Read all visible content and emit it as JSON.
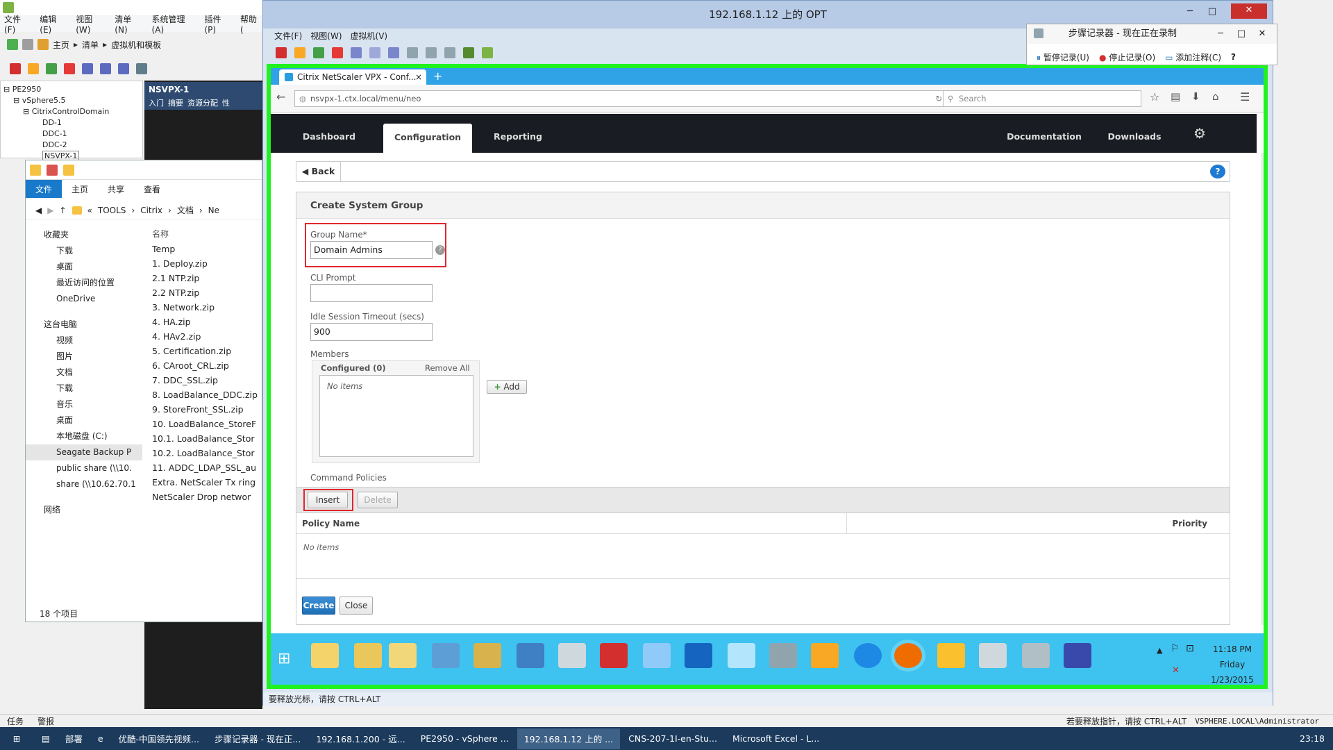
{
  "vsphere": {
    "menu": [
      "文件(F)",
      "编辑(E)",
      "视图(W)",
      "清单(N)",
      "系统管理(A)",
      "插件(P)",
      "帮助("
    ],
    "nav": {
      "home": "主页",
      "inventory": "清单",
      "vms": "虚拟机和模板"
    },
    "tree": [
      "PE2950",
      "vSphere5.5",
      "CitrixControlDomain",
      "DD-1",
      "DDC-1",
      "DDC-2",
      "NSVPX-1"
    ],
    "right_title": "NSVPX-1",
    "right_tabs": [
      "入门",
      "摘要",
      "资源分配",
      "性"
    ],
    "status_left": [
      "任务",
      "警报"
    ],
    "status_right": "若要释放指针，请按 CTRL+ALT",
    "status_user": "VSPHERE.LOCAL\\Administrator"
  },
  "explorer": {
    "ribbon": [
      "文件",
      "主页",
      "共享",
      "查看"
    ],
    "path": [
      "«",
      "TOOLS",
      "Citrix",
      "文档",
      "Ne"
    ],
    "nav": [
      {
        "label": "收藏夹",
        "group": true
      },
      {
        "label": "下载"
      },
      {
        "label": "桌面"
      },
      {
        "label": "最近访问的位置"
      },
      {
        "label": "OneDrive"
      },
      {
        "label": "这台电脑",
        "group": true
      },
      {
        "label": "视频"
      },
      {
        "label": "图片"
      },
      {
        "label": "文档"
      },
      {
        "label": "下载"
      },
      {
        "label": "音乐"
      },
      {
        "label": "桌面"
      },
      {
        "label": "本地磁盘 (C:)"
      },
      {
        "label": "Seagate Backup P"
      },
      {
        "label": "public share (\\\\10."
      },
      {
        "label": "share (\\\\10.62.70.1"
      },
      {
        "label": "网络",
        "group": true
      }
    ],
    "col_header": "名称",
    "files": [
      "Temp",
      "1. Deploy.zip",
      "2.1 NTP.zip",
      "2.2 NTP.zip",
      "3. Network.zip",
      "4. HA.zip",
      "4. HAv2.zip",
      "5. Certification.zip",
      "6. CAroot_CRL.zip",
      "7. DDC_SSL.zip",
      "8. LoadBalance_DDC.zip",
      "9. StoreFront_SSL.zip",
      "10. LoadBalance_StoreF",
      "10.1. LoadBalance_Stor",
      "10.2. LoadBalance_Stor",
      "11. ADDC_LDAP_SSL_au",
      "Extra. NetScaler Tx ring",
      "NetScaler Drop networ"
    ],
    "item_count": "18 个项目"
  },
  "vm": {
    "title": "192.168.1.12 上的 OPT",
    "menu": [
      "文件(F)",
      "视图(W)",
      "虚拟机(V)"
    ],
    "status": "要释放光标，请按 CTRL+ALT"
  },
  "steps_recorder": {
    "title": "步骤记录器 - 现在正在录制",
    "pause": "暂停记录(U)",
    "stop": "停止记录(O)",
    "comment": "添加注释(C)"
  },
  "browser": {
    "tab_title": "Citrix NetScaler VPX - Conf...",
    "url": "nsvpx-1.ctx.local/menu/neo",
    "search_placeholder": "Search"
  },
  "netscaler": {
    "tabs": [
      "Dashboard",
      "Configuration",
      "Reporting"
    ],
    "right_links": [
      "Documentation",
      "Downloads"
    ],
    "back": "Back",
    "help": "?",
    "panel_title": "Create System Group",
    "group_name_label": "Group Name*",
    "group_name_value": "Domain Admins",
    "cli_prompt_label": "CLI Prompt",
    "cli_prompt_value": "",
    "idle_label": "Idle Session Timeout (secs)",
    "idle_value": "900",
    "members_label": "Members",
    "configured": "Configured (0)",
    "remove_all": "Remove All",
    "no_items": "No items",
    "add": "Add",
    "command_policies": "Command Policies",
    "insert": "Insert",
    "delete": "Delete",
    "col_policy": "Policy Name",
    "col_priority": "Priority",
    "policy_no_items": "No items",
    "create": "Create",
    "close": "Close"
  },
  "vm_taskbar": {
    "time": "11:18 PM",
    "day": "Friday",
    "date": "1/23/2015"
  },
  "host_taskbar": {
    "items": [
      "部署",
      "优酷-中国领先视频...",
      "步骤记录器 - 现在正...",
      "192.168.1.200 - 远...",
      "PE2950 - vSphere ...",
      "192.168.1.12 上的 ...",
      "CNS-207-1I-en-Stu...",
      "Microsoft Excel - L..."
    ],
    "time": "23:18"
  },
  "colors": {
    "frame_green": "#1ff21f",
    "highlight_red": "#e0262e",
    "netscaler_nav": "#191c22",
    "browser_tab_blue": "#2fa3e6",
    "vm_taskbar": "#3ec2ef"
  }
}
